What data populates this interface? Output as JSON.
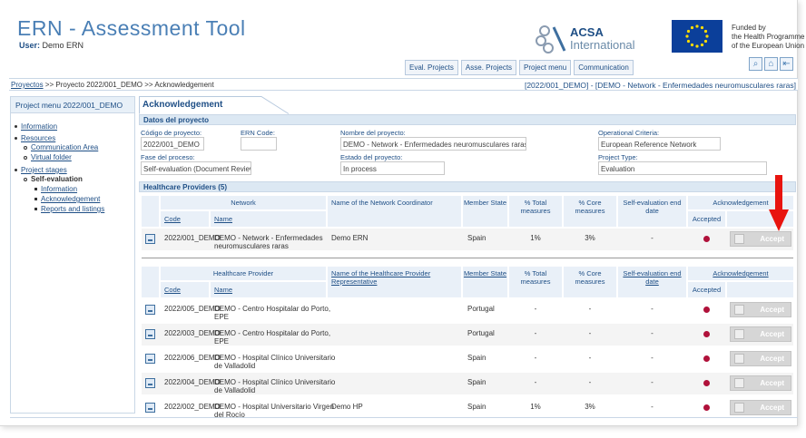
{
  "header": {
    "title": "ERN - Assessment Tool",
    "user_label": "User:",
    "user_name": "Demo ERN",
    "acsa_name": "ACSA",
    "acsa_sub": "International",
    "funded_line1": "Funded by",
    "funded_line2": "the Health Programme",
    "funded_line3": "of the European Union"
  },
  "nav": {
    "buttons": [
      "Eval. Projects",
      "Asse. Projects",
      "Project menu",
      "Communication"
    ]
  },
  "breadcrumb": {
    "root": "Proyectos",
    "rest": " >> Proyecto 2022/001_DEMO >> Acknowledgement",
    "right": "[2022/001_DEMO] - [DEMO - Network - Enfermedades neuromusculares raras]"
  },
  "sidebar": {
    "title": "Project menu 2022/001_DEMO",
    "information": "Information",
    "resources": "Resources",
    "communication_area": "Communication Area",
    "virtual_folder": "Virtual folder",
    "project_stages": "Project stages",
    "self_evaluation": "Self-evaluation",
    "sub_information": "Information",
    "sub_acknowledgement": "Acknowledgement",
    "sub_reports": "Reports and listings"
  },
  "main": {
    "tab": "Acknowledgement",
    "project_section": "Datos del proyecto",
    "fields": {
      "code_label": "Código de proyecto:",
      "code_value": "2022/001_DEMO",
      "ern_label": "ERN Code:",
      "ern_value": "",
      "name_label": "Nombre del proyecto:",
      "name_value": "DEMO - Network - Enfermedades neuromusculares raras",
      "criteria_label": "Operational Criteria:",
      "criteria_value": "European Reference Network",
      "phase_label": "Fase del proceso:",
      "phase_value": "Self-evaluation (Document Review)",
      "state_label": "Estado del proyecto:",
      "state_value": "In process",
      "type_label": "Project Type:",
      "type_value": "Evaluation"
    },
    "providers_section": "Healthcare Providers (5)"
  },
  "network_table": {
    "group_header": "Network",
    "code_header": "Code",
    "name_header": "Name",
    "coordinator_header": "Name of the Network Coordinator",
    "member_header": "Member State",
    "total_header": "% Total measures",
    "core_header": "% Core measures",
    "enddate_header": "Self-evaluation end date",
    "ack_header": "Acknowledgement",
    "accepted_header": "Accepted",
    "rows": [
      {
        "code": "2022/001_DEMO",
        "name1": "DEMO - Network - Enfermedades",
        "name2": "neuromusculares raras",
        "coordinator": "Demo ERN",
        "member": "Spain",
        "total": "1%",
        "core": "3%",
        "enddate": "-",
        "accept": "Accept"
      }
    ]
  },
  "provider_table": {
    "group_header": "Healthcare Provider",
    "code_header": "Code",
    "name_header": "Name",
    "rep_header": "Name of the Healthcare Provider Representative",
    "member_header": "Member State",
    "total_header": "% Total measures",
    "core_header": "% Core measures",
    "enddate_header": "Self-evaluation end date",
    "ack_header": "Acknowledgement",
    "accepted_header": "Accepted",
    "rows": [
      {
        "code": "2022/005_DEMO",
        "name1": "DEMO - Centro Hospitalar do Porto,",
        "name2": "EPE",
        "rep": "",
        "member": "Portugal",
        "total": "-",
        "core": "-",
        "enddate": "-",
        "accept": "Accept"
      },
      {
        "code": "2022/003_DEMO",
        "name1": "DEMO - Centro Hospitalar do Porto,",
        "name2": "EPE",
        "rep": "",
        "member": "Portugal",
        "total": "-",
        "core": "-",
        "enddate": "-",
        "accept": "Accept"
      },
      {
        "code": "2022/006_DEMO",
        "name1": "DEMO - Hospital Clínico Universitario",
        "name2": "de Valladolid",
        "rep": "",
        "member": "Spain",
        "total": "-",
        "core": "-",
        "enddate": "-",
        "accept": "Accept"
      },
      {
        "code": "2022/004_DEMO",
        "name1": "DEMO - Hospital Clínico Universitario",
        "name2": "de Valladolid",
        "rep": "",
        "member": "Spain",
        "total": "-",
        "core": "-",
        "enddate": "-",
        "accept": "Accept"
      },
      {
        "code": "2022/002_DEMO",
        "name1": "DEMO - Hospital Universitario Virgen",
        "name2": "del Rocío",
        "rep": "Demo HP",
        "member": "Spain",
        "total": "1%",
        "core": "3%",
        "enddate": "-",
        "accept": "Accept"
      }
    ]
  },
  "colors": {
    "accent": "#4a7fb5",
    "link": "#1f4f86",
    "status_dot": "#b0113a",
    "annotation_arrow": "#e8140f"
  }
}
